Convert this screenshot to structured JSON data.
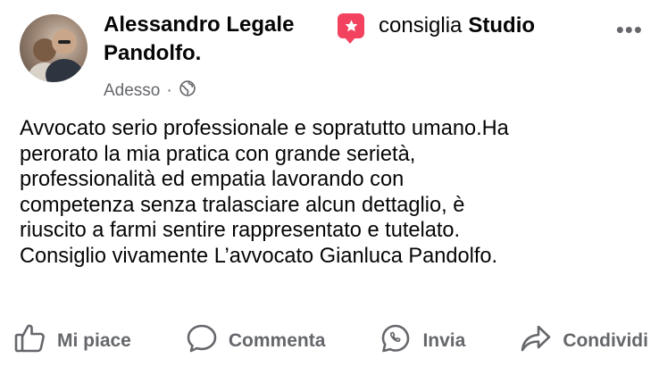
{
  "post": {
    "author": "Alessandro Legale Pandolfo.",
    "recommend_verb": "consiglia",
    "recommend_target": "Studio",
    "timestamp": "Adesso",
    "separator": "·",
    "privacy_icon": "globe-icon",
    "more_label": "•••",
    "text": "Avvocato serio professionale e sopratutto umano.Ha\nperorato la mia pratica con grande serietà,\nprofessionalità ed empatia lavorando con\ncompetenza senza tralasciare alcun dettaglio, è\nriuscito a farmi sentire rappresentato e tutelato.\nConsiglio vivamente L’avvocato Gianluca Pandolfo."
  },
  "actions": {
    "like": "Mi piace",
    "comment": "Commenta",
    "send": "Invia",
    "share": "Condividi"
  },
  "colors": {
    "recommend_badge": "#f3425f",
    "secondary_text": "#65676b"
  }
}
